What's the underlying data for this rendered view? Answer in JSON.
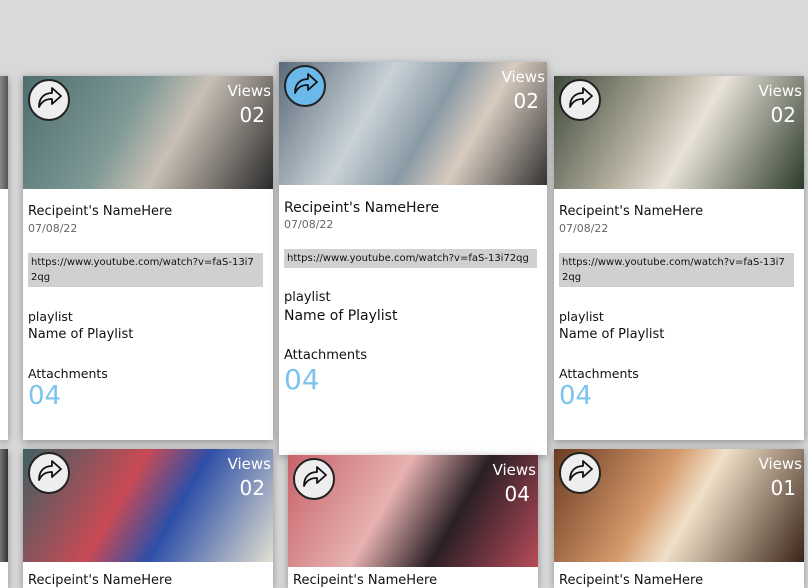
{
  "views_label": "Views",
  "colors": {
    "accent": "#7cc4ee",
    "share_active": "#6ab9ea"
  },
  "cards": [
    {
      "name": "Recipeint's NameHere",
      "date": "07/08/22",
      "url": "https://www.youtube.com/watch?v=faS-13i72qg",
      "playlist_label": "playlist",
      "playlist": "Name of Playlist",
      "attachments_label": "Attachments",
      "attachments": "04",
      "views": "02",
      "icon": "share-icon"
    },
    {
      "name": "Recipeint's NameHere",
      "date": "07/08/22",
      "url": "https://www.youtube.com/watch?v=faS-13i72qg",
      "playlist_label": "playlist",
      "playlist": "Name of Playlist",
      "attachments_label": "Attachments",
      "attachments": "04",
      "views": "02",
      "icon": "share-icon",
      "active": true
    },
    {
      "name": "Recipeint's NameHere",
      "date": "07/08/22",
      "url": "https://www.youtube.com/watch?v=faS-13i72qg",
      "playlist_label": "playlist",
      "playlist": "Name of Playlist",
      "attachments_label": "Attachments",
      "attachments": "04",
      "views": "02",
      "icon": "share-icon"
    },
    {
      "name": "Recipeint's NameHere",
      "views": "02",
      "icon": "share-icon"
    },
    {
      "name": "Recipeint's NameHere",
      "views": "04",
      "icon": "share-icon"
    },
    {
      "name": "Recipeint's NameHere",
      "views": "01",
      "icon": "share-icon"
    }
  ]
}
